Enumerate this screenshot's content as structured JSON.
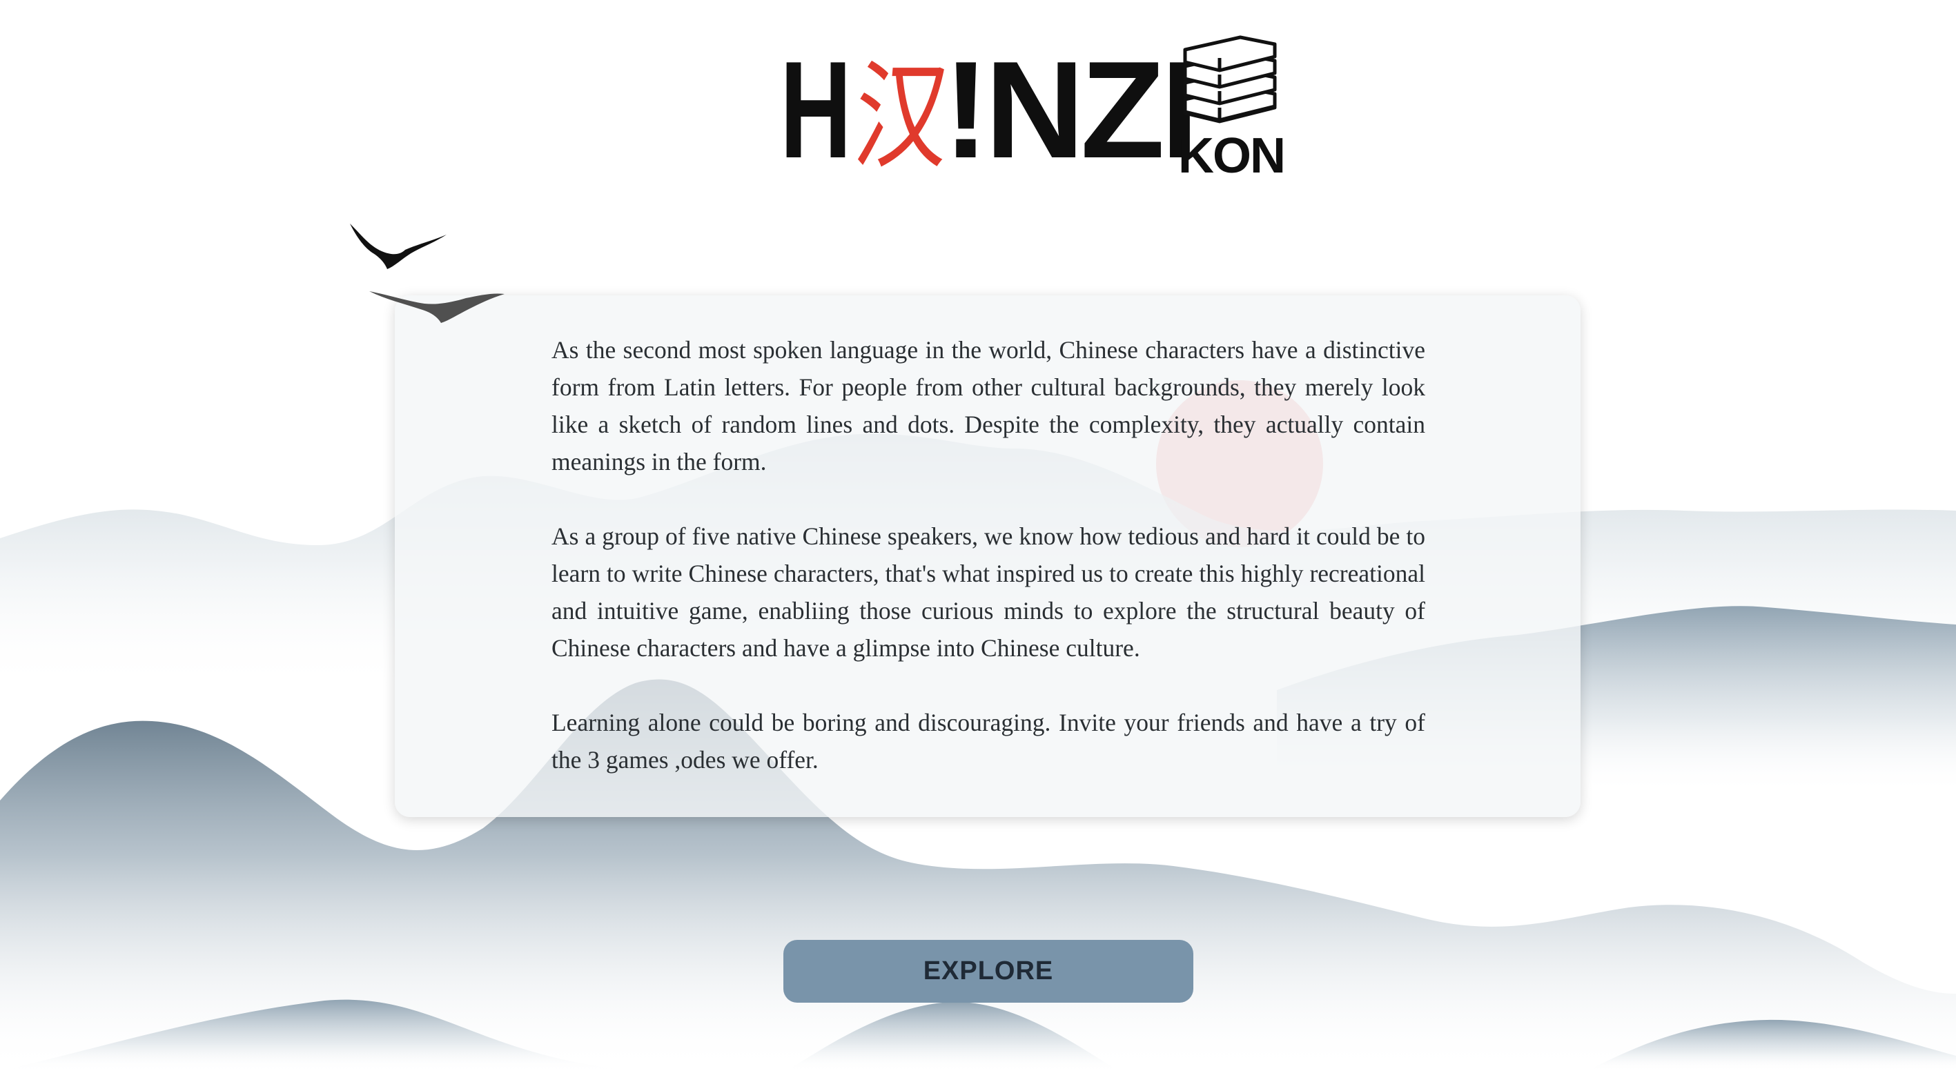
{
  "logo": {
    "first_letter": "H",
    "red_glyph": "汉",
    "rest": "NZI",
    "sub": "KON",
    "icon": "book-stack-icon"
  },
  "content": {
    "paragraphs": [
      "As the second most spoken language in the world, Chinese characters have a distinctive form from Latin letters. For people from other cultural backgrounds, they merely look like a sketch of random lines and dots. Despite the complexity, they actually contain meanings in the form.",
      "As a group of five native Chinese speakers, we know how tedious and hard it could be to learn to write Chinese characters, that's what inspired us to create this highly recreational and intuitive game, enabliing those curious minds to explore the structural beauty of Chinese characters and have a glimpse into Chinese culture.",
      "Learning alone could be boring and discouraging. Invite your friends and have a try of the 3 games ,odes we offer."
    ]
  },
  "explore_button": {
    "label": "EXPLORE"
  },
  "colors": {
    "accent_red": "#e03a2c",
    "button": "#7994aa",
    "mountain_dark": "#4f6678",
    "mountain_light": "#c9d3da",
    "sun": "#ef9d9b"
  }
}
